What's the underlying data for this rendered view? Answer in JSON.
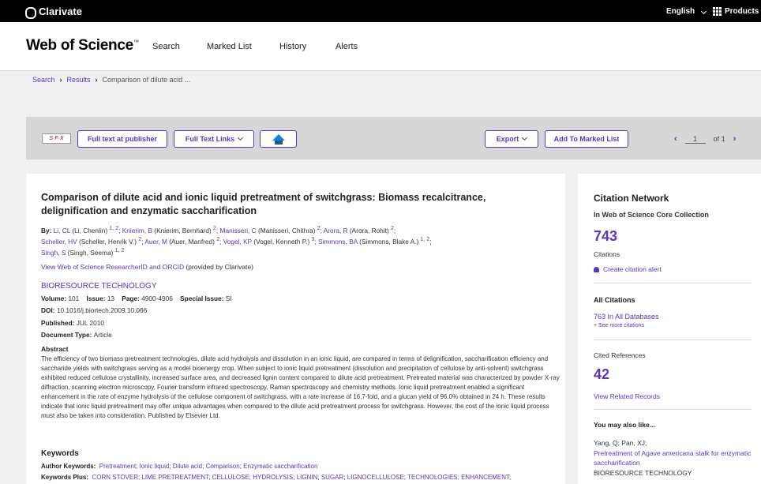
{
  "topbar": {
    "brand": "Clarivate",
    "language": "English",
    "products": "Products"
  },
  "nav": {
    "brand": "Web of Science",
    "brand_tm": "™",
    "links": [
      "Search",
      "Marked List",
      "History",
      "Alerts"
    ]
  },
  "breadcrumb": {
    "search": "Search",
    "results": "Results",
    "current": "Comparison of dilute acid ..."
  },
  "toolbar": {
    "sfx": "S·F·X",
    "full_text_publisher": "Full text at publisher",
    "full_text_links": "Full Text Links",
    "export": "Export",
    "add_marked": "Add To Marked List",
    "page": "1",
    "page_of": "of 1"
  },
  "record": {
    "title": "Comparison of dilute acid and ionic liquid pretreatment of switchgrass: Biomass recalcitrance, delignification and enzymatic saccharification",
    "by_label": "By:",
    "authors": [
      {
        "short": "Li, CL",
        "full": " (Li, Chenlin) ",
        "sup": "1, 2",
        "sep": "; "
      },
      {
        "short": "Knierim, B",
        "full": " (Knierim, Bernhard) ",
        "sup": "2",
        "sep": "; "
      },
      {
        "short": "Manisseri, C",
        "full": " (Manisseri, Chithra) ",
        "sup": "2",
        "sep": "; "
      },
      {
        "short": "Arora, R",
        "full": " (Arora, Rohit) ",
        "sup": "2",
        "sep": ";"
      },
      {
        "short": "Scheller, HV",
        "full": " (Scheller, Henrik V.) ",
        "sup": "2",
        "sep": "; "
      },
      {
        "short": "Auer, M",
        "full": " (Auer, Manfred) ",
        "sup": "2",
        "sep": "; "
      },
      {
        "short": "Vogel, KP",
        "full": " (Vogel, Kenneth P.) ",
        "sup": "3",
        "sep": "; "
      },
      {
        "short": "Simmons, BA",
        "full": " (Simmons, Blake A.) ",
        "sup": "1, 2",
        "sep": ";"
      },
      {
        "short": "Singh, S",
        "full": " (Singh, Seema) ",
        "sup": "1, 2",
        "sep": ""
      }
    ],
    "rid_link": "View Web of Science ResearcherID and ORCID",
    "rid_rest": " (provided by Clarivate)",
    "journal": "BIORESOURCE TECHNOLOGY",
    "volume_label": "Volume:",
    "volume": "101",
    "issue_label": "Issue:",
    "issue": "13",
    "page_label": "Page:",
    "pages": "4900-4906",
    "special_label": "Special Issue:",
    "special": "SI",
    "doi_label": "DOI:",
    "doi": "10.1016/j.biortech.2009.10.066",
    "published_label": "Published:",
    "published": "JUL 2010",
    "doctype_label": "Document Type:",
    "doctype": "Article",
    "abstract_heading": "Abstract",
    "abstract": "The efficiency of two biomass pretreatment technologies, dilute acid hydrolysis and dissolution in an ionic liquid, are compared in terms of delignification, saccharification efficiency and saccharide yields with switchgrass serving as a model bioenergy crop. When subject to ionic liquid pretreatment (dissolution and precipitation of cellulose by anti-solvent) switchgrass exhibited reduced cellulose crystallinity, increased surface area, and decreased lignin content compared to dilute acid pretreatment. Pretreated material was characterized by powder X-ray diffraction, scanning electron microscopy, Fourier transform infrared spectroscopy, Raman spectroscopy and chemistry methods. Ionic liquid pretreatment enabled a significant enhancement in the rate of enzyme hydrolysis of the cellulose component of switchgrass, with a rate increase of 16.7-fold, and a glucan yield of 96.0% obtained in 24 h. These results indicate that ionic liquid pretreatment may offer unique advantages when compared to the dilute acid pretreatment process for switchgrass. However, the cost of the ionic liquid process must also be taken into consideration. Published by Elsevier Ltd.",
    "keywords_heading": "Keywords",
    "author_kw_label": "Author Keywords:",
    "author_keywords": [
      "Pretreatment",
      "Ionic liquid",
      "Dilute acid",
      "Comparison",
      "Enzymatic saccharification"
    ],
    "kw_plus_label": "Keywords Plus:",
    "keywords_plus": [
      "CORN STOVER",
      "LIME PRETREATMENT",
      "CELLULOSE",
      "HYDROLYSIS",
      "LIGNIN",
      "SUGAR",
      "LIGNOCELLULOSE",
      "TECHNOLOGIES",
      "ENHANCEMENT"
    ]
  },
  "sidebar": {
    "heading": "Citation Network",
    "subheading": "In Web of Science Core Collection",
    "citations_count": "743",
    "citations_label": "Citations",
    "alert": "Create citation alert",
    "all_citations_heading": "All Citations",
    "all_db": "763 In All Databases",
    "see_more": "+ See more citations",
    "cited_refs_label": "Cited References",
    "cited_refs_count": "42",
    "related": "View Related Records",
    "also_like": "You may also like...",
    "rec_authors": "Yang, Q; Pan, XJ;",
    "rec_title": "Pretreatment of Agave americana stalk for enzymatic saccharification",
    "rec_journal": "BIORESOURCE TECHNOLOGY"
  },
  "colors": {
    "accent": "#5e33bf",
    "topbar": "#000000",
    "toolbar": "#d6d6d6"
  }
}
